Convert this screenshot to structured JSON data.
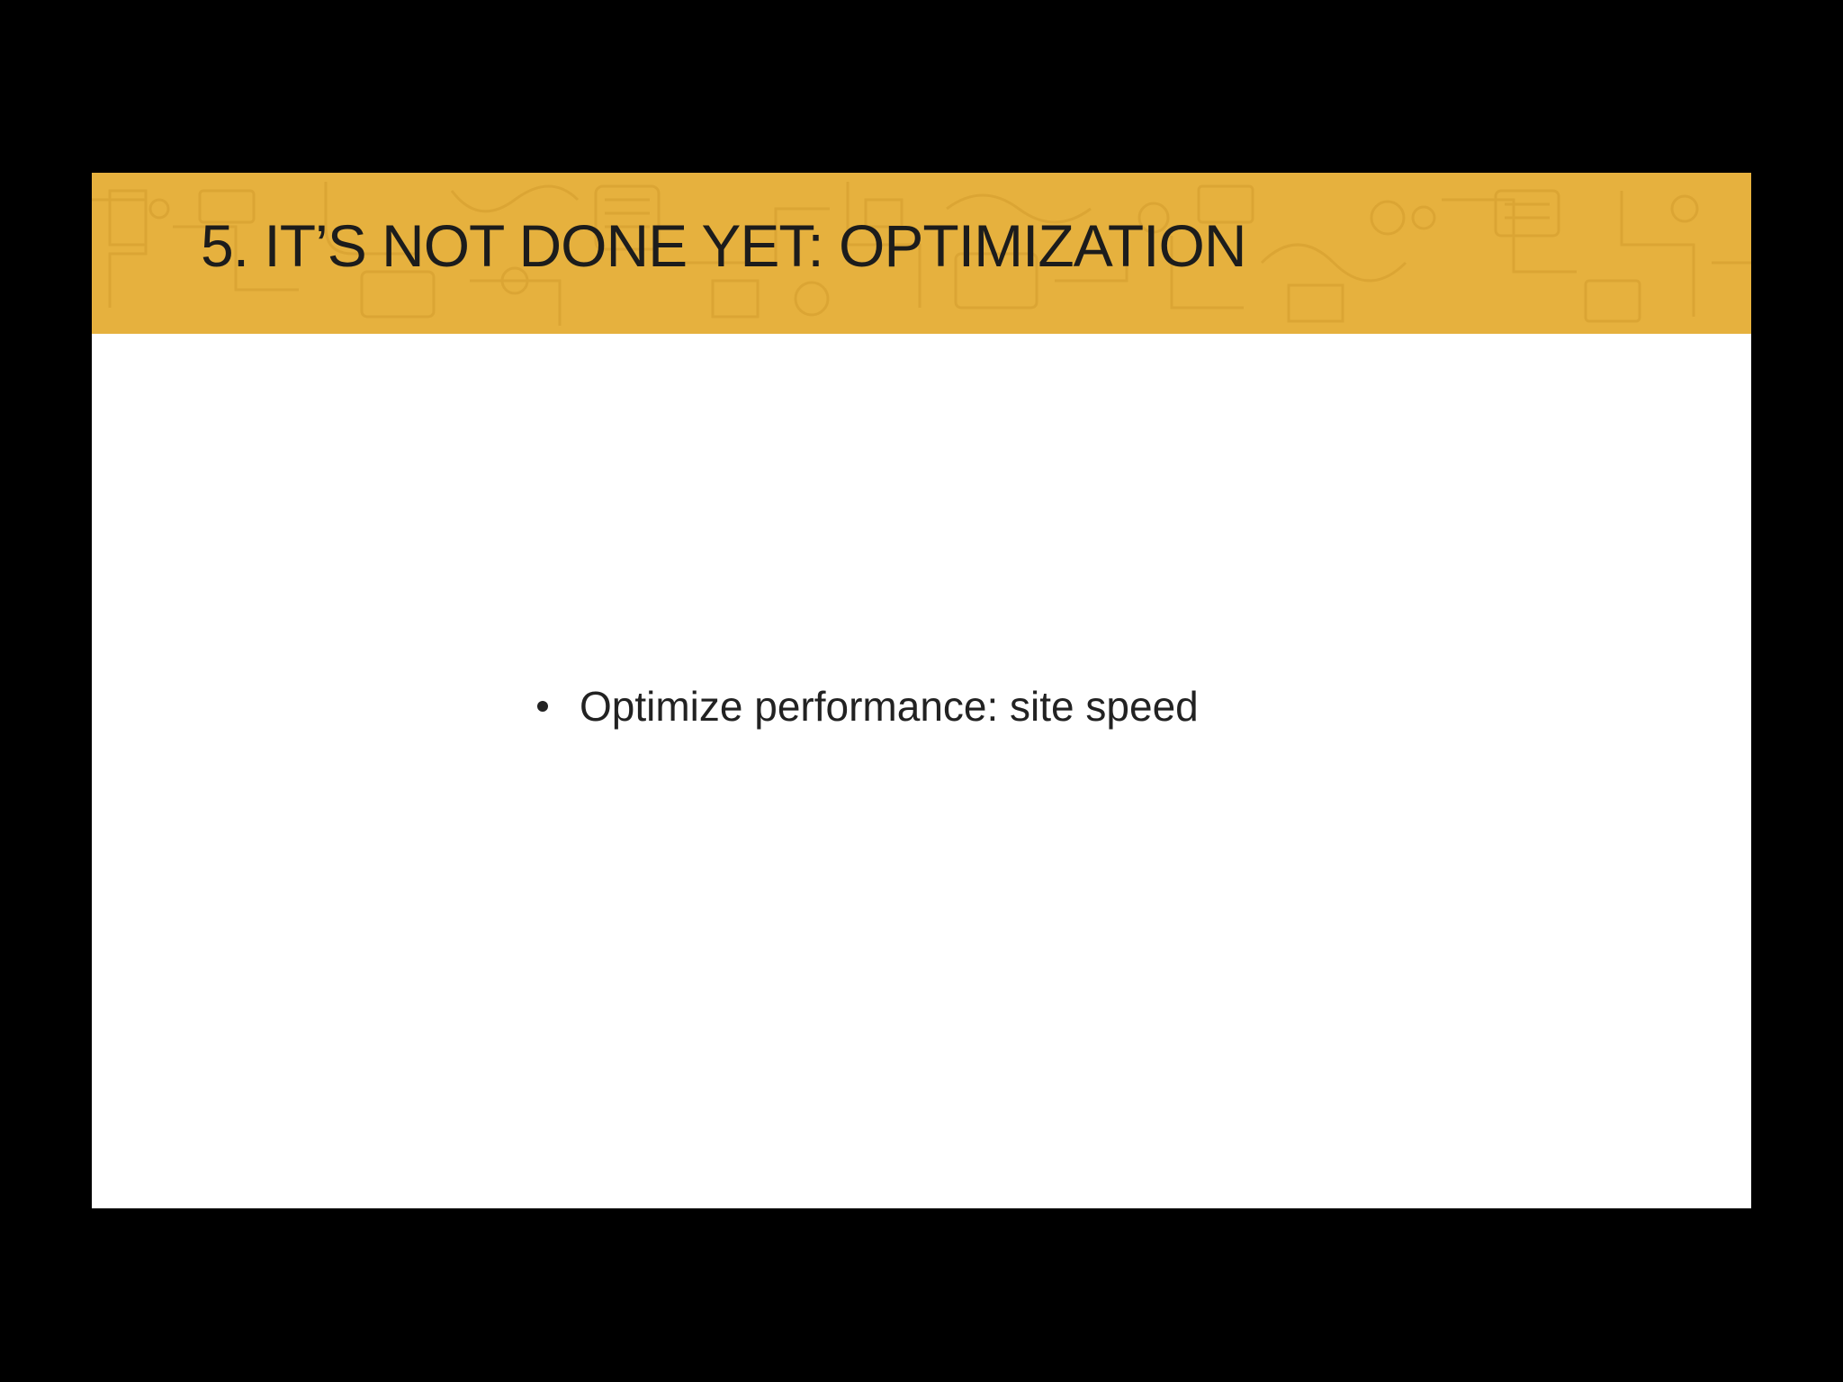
{
  "slide": {
    "title": "5. IT’S NOT DONE YET: OPTIMIZATION",
    "bullets": [
      {
        "text": "Optimize performance: site speed"
      }
    ]
  },
  "colors": {
    "background": "#000000",
    "title_bar": "#e6b13e",
    "title_bar_pattern": "#d9a232",
    "slide_body": "#ffffff",
    "text": "#1c1c1c"
  }
}
